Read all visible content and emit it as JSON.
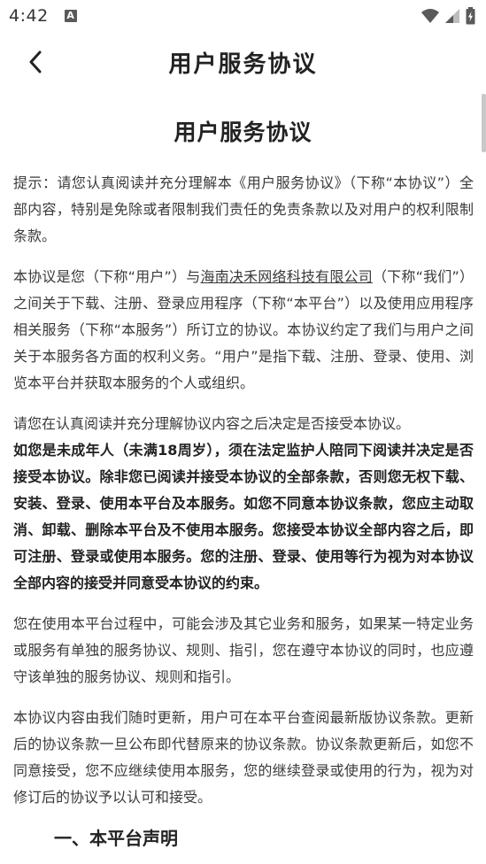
{
  "status_bar": {
    "time": "4:42",
    "notification_icon": "a-letter-icon",
    "notification_letter": "A",
    "icons": [
      "wifi-icon",
      "cellular-signal-icon",
      "battery-charging-icon"
    ]
  },
  "app_bar": {
    "back_icon": "chevron-left-icon",
    "title": "用户服务协议"
  },
  "document": {
    "title": "用户服务协议",
    "para1": "提示：请您认真阅读并充分理解本《用户服务协议》（下称“本协议”）全部内容，特别是免除或者限制我们责任的免责条款以及对用户的权利限制条款。",
    "para2_before": "本协议是您（下称“用户”）与",
    "para2_company": "海南决禾网络科技有限公司",
    "para2_after": "（下称“我们”）之间关于下载、注册、登录应用程序（下称“本平台”）以及使用应用程序相关服务（下称“本服务”）所订立的协议。本协议约定了我们与用户之间关于本服务各方面的权利义务。“用户”是指下载、注册、登录、使用、浏览本平台并获取本服务的个人或组织。",
    "para3_normal": "请您在认真阅读并充分理解协议内容之后决定是否接受本协议。",
    "para3_bold": "如您是未成年人（未满18周岁），须在法定监护人陪同下阅读并决定是否接受本协议。除非您已阅读并接受本协议的全部条款，否则您无权下载、安装、登录、使用本平台及本服务。如您不同意本协议条款，您应主动取消、卸载、删除本平台及不使用本服务。您接受本协议全部内容之后，即可注册、登录或使用本服务。您的注册、登录、使用等行为视为对本协议全部内容的接受并同意受本协议的约束。",
    "para4": "您在使用本平台过程中，可能会涉及其它业务和服务，如果某一特定业务或服务有单独的服务协议、规则、指引，您在遵守本协议的同时，也应遵守该单独的服务协议、规则和指引。",
    "para5": "本协议内容由我们随时更新，用户可在本平台查阅最新版协议条款。更新后的协议条款一旦公布即代替原来的协议条款。协议条款更新后，如您不同意接受，您不应继续使用本服务，您的继续登录或使用的行为，视为对修订后的协议予以认可和接受。",
    "section_title": "一、本平台声明"
  }
}
